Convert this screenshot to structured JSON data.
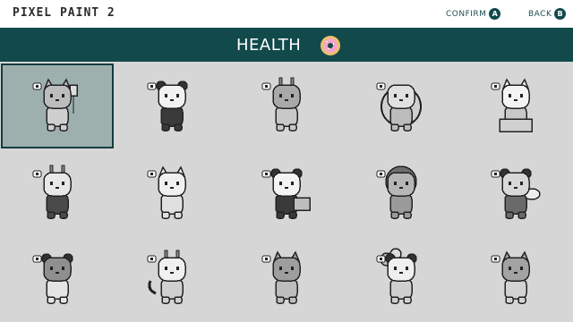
{
  "app": {
    "title": "PIXEL PAINT 2"
  },
  "controls": {
    "confirm": {
      "label": "CONFIRM",
      "key": "A"
    },
    "back": {
      "label": "BACK",
      "key": "B"
    }
  },
  "category": {
    "title": "HEALTH",
    "icon": "donut-icon"
  },
  "puzzles": [
    {
      "subject": "cat with iv drip",
      "selected": true
    },
    {
      "subject": "panda"
    },
    {
      "subject": "giraffe"
    },
    {
      "subject": "sleeping creature in moon"
    },
    {
      "subject": "cat in box"
    },
    {
      "subject": "cow"
    },
    {
      "subject": "cow character"
    },
    {
      "subject": "panda with cart"
    },
    {
      "subject": "lion"
    },
    {
      "subject": "bee"
    },
    {
      "subject": "sloth"
    },
    {
      "subject": "unicorn"
    },
    {
      "subject": "dog"
    },
    {
      "subject": "child with balloons"
    },
    {
      "subject": "fox"
    }
  ],
  "colors": {
    "teal": "#124a4c",
    "selected_tile": "#9db0ae",
    "background": "#d6d6d6"
  }
}
